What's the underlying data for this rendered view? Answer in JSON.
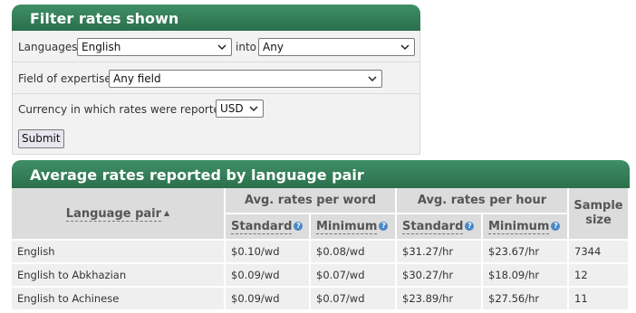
{
  "filter": {
    "title": "Filter rates shown",
    "languages_label": "Languages:",
    "language_from": "English",
    "into_label": "into",
    "language_to": "Any",
    "field_label": "Field of expertise:",
    "field_value": "Any field",
    "currency_label": "Currency in which rates were reported:",
    "currency_value": "USD",
    "submit_label": "Submit"
  },
  "rates": {
    "title": "Average rates reported by language pair",
    "col_language_pair": "Language pair",
    "col_per_word": "Avg. rates per word",
    "col_per_hour": "Avg. rates per hour",
    "col_sample_line1": "Sample",
    "col_sample_line2": "size",
    "sub_standard": "Standard",
    "sub_minimum": "Minimum",
    "rows": [
      {
        "pair": "English",
        "word_std": "$0.10/wd",
        "word_min": "$0.08/wd",
        "hour_std": "$31.27/hr",
        "hour_min": "$23.67/hr",
        "sample": "7344"
      },
      {
        "pair": "English to Abkhazian",
        "word_std": "$0.09/wd",
        "word_min": "$0.07/wd",
        "hour_std": "$30.27/hr",
        "hour_min": "$18.09/hr",
        "sample": "12"
      },
      {
        "pair": "English to Achinese",
        "word_std": "$0.09/wd",
        "word_min": "$0.07/wd",
        "hour_std": "$23.89/hr",
        "hour_min": "$27.56/hr",
        "sample": "11"
      }
    ]
  },
  "colors": {
    "header_green": "#2f7a55",
    "help_icon": "#4a87c7"
  },
  "icons": {
    "sort": "sort-ascending-icon",
    "help": "help-icon",
    "dropdown": "chevron-down-icon"
  }
}
